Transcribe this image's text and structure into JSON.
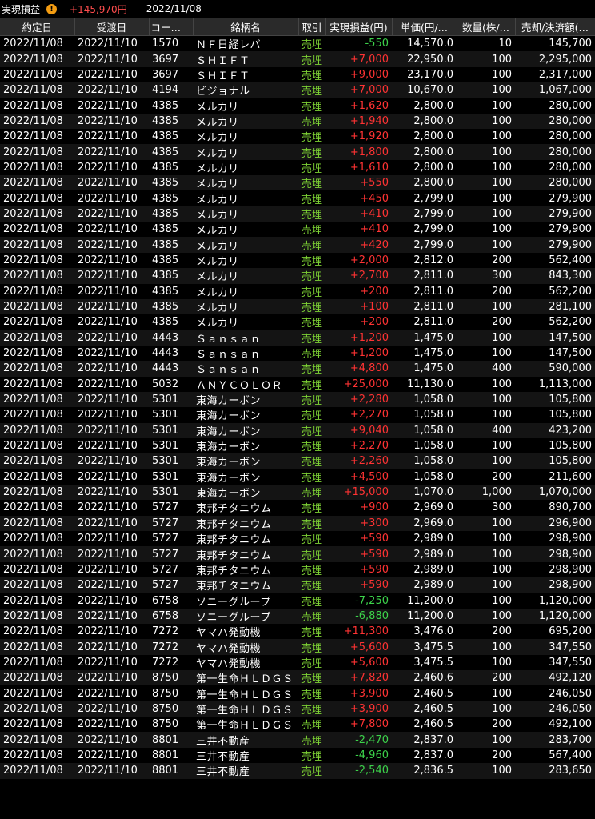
{
  "summary": {
    "label": "実現損益",
    "pnl": "+145,970円",
    "date": "2022/11/08"
  },
  "columns": [
    "約定日",
    "受渡日",
    "コード/…",
    "銘柄名",
    "取引",
    "実現損益(円)",
    "単価(円/…",
    "数量(株/…",
    "売却/決済額(…"
  ],
  "rows": [
    [
      "2022/11/08",
      "2022/11/10",
      "1570",
      "ＮＦ日経レバ",
      "売埋",
      "-550",
      "14,570.0",
      "10",
      "145,700"
    ],
    [
      "2022/11/08",
      "2022/11/10",
      "3697",
      "ＳＨＩＦＴ",
      "売埋",
      "+7,000",
      "22,950.0",
      "100",
      "2,295,000"
    ],
    [
      "2022/11/08",
      "2022/11/10",
      "3697",
      "ＳＨＩＦＴ",
      "売埋",
      "+9,000",
      "23,170.0",
      "100",
      "2,317,000"
    ],
    [
      "2022/11/08",
      "2022/11/10",
      "4194",
      "ビジョナル",
      "売埋",
      "+7,000",
      "10,670.0",
      "100",
      "1,067,000"
    ],
    [
      "2022/11/08",
      "2022/11/10",
      "4385",
      "メルカリ",
      "売埋",
      "+1,620",
      "2,800.0",
      "100",
      "280,000"
    ],
    [
      "2022/11/08",
      "2022/11/10",
      "4385",
      "メルカリ",
      "売埋",
      "+1,940",
      "2,800.0",
      "100",
      "280,000"
    ],
    [
      "2022/11/08",
      "2022/11/10",
      "4385",
      "メルカリ",
      "売埋",
      "+1,920",
      "2,800.0",
      "100",
      "280,000"
    ],
    [
      "2022/11/08",
      "2022/11/10",
      "4385",
      "メルカリ",
      "売埋",
      "+1,800",
      "2,800.0",
      "100",
      "280,000"
    ],
    [
      "2022/11/08",
      "2022/11/10",
      "4385",
      "メルカリ",
      "売埋",
      "+1,610",
      "2,800.0",
      "100",
      "280,000"
    ],
    [
      "2022/11/08",
      "2022/11/10",
      "4385",
      "メルカリ",
      "売埋",
      "+550",
      "2,800.0",
      "100",
      "280,000"
    ],
    [
      "2022/11/08",
      "2022/11/10",
      "4385",
      "メルカリ",
      "売埋",
      "+450",
      "2,799.0",
      "100",
      "279,900"
    ],
    [
      "2022/11/08",
      "2022/11/10",
      "4385",
      "メルカリ",
      "売埋",
      "+410",
      "2,799.0",
      "100",
      "279,900"
    ],
    [
      "2022/11/08",
      "2022/11/10",
      "4385",
      "メルカリ",
      "売埋",
      "+410",
      "2,799.0",
      "100",
      "279,900"
    ],
    [
      "2022/11/08",
      "2022/11/10",
      "4385",
      "メルカリ",
      "売埋",
      "+420",
      "2,799.0",
      "100",
      "279,900"
    ],
    [
      "2022/11/08",
      "2022/11/10",
      "4385",
      "メルカリ",
      "売埋",
      "+2,000",
      "2,812.0",
      "200",
      "562,400"
    ],
    [
      "2022/11/08",
      "2022/11/10",
      "4385",
      "メルカリ",
      "売埋",
      "+2,700",
      "2,811.0",
      "300",
      "843,300"
    ],
    [
      "2022/11/08",
      "2022/11/10",
      "4385",
      "メルカリ",
      "売埋",
      "+200",
      "2,811.0",
      "200",
      "562,200"
    ],
    [
      "2022/11/08",
      "2022/11/10",
      "4385",
      "メルカリ",
      "売埋",
      "+100",
      "2,811.0",
      "100",
      "281,100"
    ],
    [
      "2022/11/08",
      "2022/11/10",
      "4385",
      "メルカリ",
      "売埋",
      "+200",
      "2,811.0",
      "200",
      "562,200"
    ],
    [
      "2022/11/08",
      "2022/11/10",
      "4443",
      "Ｓａｎｓａｎ",
      "売埋",
      "+1,200",
      "1,475.0",
      "100",
      "147,500"
    ],
    [
      "2022/11/08",
      "2022/11/10",
      "4443",
      "Ｓａｎｓａｎ",
      "売埋",
      "+1,200",
      "1,475.0",
      "100",
      "147,500"
    ],
    [
      "2022/11/08",
      "2022/11/10",
      "4443",
      "Ｓａｎｓａｎ",
      "売埋",
      "+4,800",
      "1,475.0",
      "400",
      "590,000"
    ],
    [
      "2022/11/08",
      "2022/11/10",
      "5032",
      "ＡＮＹＣＯＬＯＲ",
      "売埋",
      "+25,000",
      "11,130.0",
      "100",
      "1,113,000"
    ],
    [
      "2022/11/08",
      "2022/11/10",
      "5301",
      "東海カーボン",
      "売埋",
      "+2,280",
      "1,058.0",
      "100",
      "105,800"
    ],
    [
      "2022/11/08",
      "2022/11/10",
      "5301",
      "東海カーボン",
      "売埋",
      "+2,270",
      "1,058.0",
      "100",
      "105,800"
    ],
    [
      "2022/11/08",
      "2022/11/10",
      "5301",
      "東海カーボン",
      "売埋",
      "+9,040",
      "1,058.0",
      "400",
      "423,200"
    ],
    [
      "2022/11/08",
      "2022/11/10",
      "5301",
      "東海カーボン",
      "売埋",
      "+2,270",
      "1,058.0",
      "100",
      "105,800"
    ],
    [
      "2022/11/08",
      "2022/11/10",
      "5301",
      "東海カーボン",
      "売埋",
      "+2,260",
      "1,058.0",
      "100",
      "105,800"
    ],
    [
      "2022/11/08",
      "2022/11/10",
      "5301",
      "東海カーボン",
      "売埋",
      "+4,500",
      "1,058.0",
      "200",
      "211,600"
    ],
    [
      "2022/11/08",
      "2022/11/10",
      "5301",
      "東海カーボン",
      "売埋",
      "+15,000",
      "1,070.0",
      "1,000",
      "1,070,000"
    ],
    [
      "2022/11/08",
      "2022/11/10",
      "5727",
      "東邦チタニウム",
      "売埋",
      "+900",
      "2,969.0",
      "300",
      "890,700"
    ],
    [
      "2022/11/08",
      "2022/11/10",
      "5727",
      "東邦チタニウム",
      "売埋",
      "+300",
      "2,969.0",
      "100",
      "296,900"
    ],
    [
      "2022/11/08",
      "2022/11/10",
      "5727",
      "東邦チタニウム",
      "売埋",
      "+590",
      "2,989.0",
      "100",
      "298,900"
    ],
    [
      "2022/11/08",
      "2022/11/10",
      "5727",
      "東邦チタニウム",
      "売埋",
      "+590",
      "2,989.0",
      "100",
      "298,900"
    ],
    [
      "2022/11/08",
      "2022/11/10",
      "5727",
      "東邦チタニウム",
      "売埋",
      "+590",
      "2,989.0",
      "100",
      "298,900"
    ],
    [
      "2022/11/08",
      "2022/11/10",
      "5727",
      "東邦チタニウム",
      "売埋",
      "+590",
      "2,989.0",
      "100",
      "298,900"
    ],
    [
      "2022/11/08",
      "2022/11/10",
      "6758",
      "ソニーグループ",
      "売埋",
      "-7,250",
      "11,200.0",
      "100",
      "1,120,000"
    ],
    [
      "2022/11/08",
      "2022/11/10",
      "6758",
      "ソニーグループ",
      "売埋",
      "-6,880",
      "11,200.0",
      "100",
      "1,120,000"
    ],
    [
      "2022/11/08",
      "2022/11/10",
      "7272",
      "ヤマハ発動機",
      "売埋",
      "+11,300",
      "3,476.0",
      "200",
      "695,200"
    ],
    [
      "2022/11/08",
      "2022/11/10",
      "7272",
      "ヤマハ発動機",
      "売埋",
      "+5,600",
      "3,475.5",
      "100",
      "347,550"
    ],
    [
      "2022/11/08",
      "2022/11/10",
      "7272",
      "ヤマハ発動機",
      "売埋",
      "+5,600",
      "3,475.5",
      "100",
      "347,550"
    ],
    [
      "2022/11/08",
      "2022/11/10",
      "8750",
      "第一生命ＨＬＤＧＳ",
      "売埋",
      "+7,820",
      "2,460.6",
      "200",
      "492,120"
    ],
    [
      "2022/11/08",
      "2022/11/10",
      "8750",
      "第一生命ＨＬＤＧＳ",
      "売埋",
      "+3,900",
      "2,460.5",
      "100",
      "246,050"
    ],
    [
      "2022/11/08",
      "2022/11/10",
      "8750",
      "第一生命ＨＬＤＧＳ",
      "売埋",
      "+3,900",
      "2,460.5",
      "100",
      "246,050"
    ],
    [
      "2022/11/08",
      "2022/11/10",
      "8750",
      "第一生命ＨＬＤＧＳ",
      "売埋",
      "+7,800",
      "2,460.5",
      "200",
      "492,100"
    ],
    [
      "2022/11/08",
      "2022/11/10",
      "8801",
      "三井不動産",
      "売埋",
      "-2,470",
      "2,837.0",
      "100",
      "283,700"
    ],
    [
      "2022/11/08",
      "2022/11/10",
      "8801",
      "三井不動産",
      "売埋",
      "-4,960",
      "2,837.0",
      "200",
      "567,400"
    ],
    [
      "2022/11/08",
      "2022/11/10",
      "8801",
      "三井不動産",
      "売埋",
      "-2,540",
      "2,836.5",
      "100",
      "283,650"
    ]
  ]
}
